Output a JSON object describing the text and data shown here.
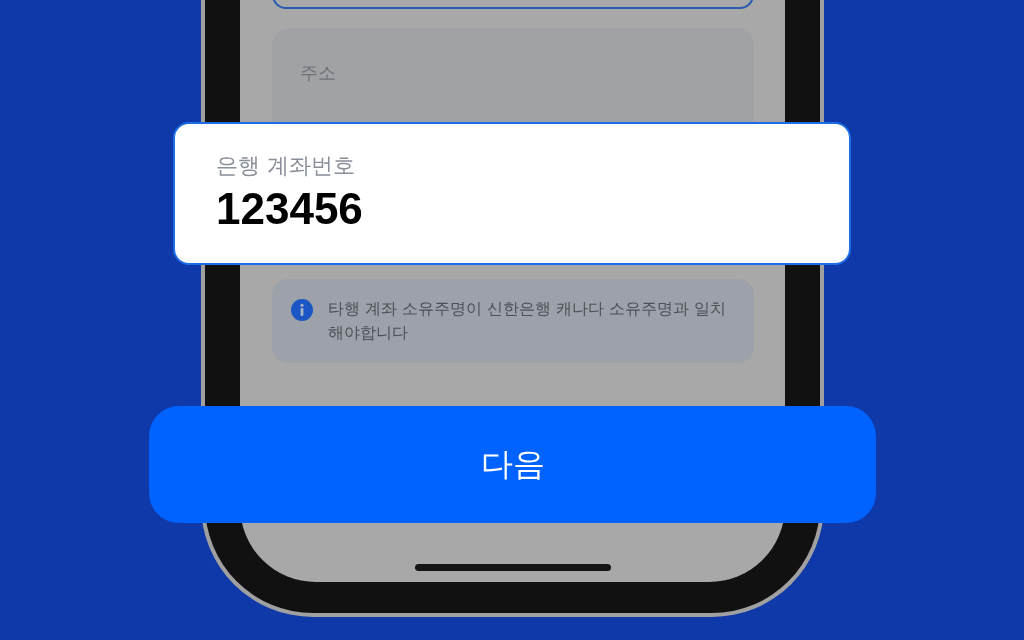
{
  "screen": {
    "address_field": {
      "label": "주소"
    },
    "info_notice": {
      "text": "타행 계좌 소유주명이 신한은행 캐나다 소유주명과 일치해야합니다"
    }
  },
  "account_field": {
    "label": "은행 계좌번호",
    "value": "123456",
    "focused": true
  },
  "next_button": {
    "label": "다음"
  }
}
